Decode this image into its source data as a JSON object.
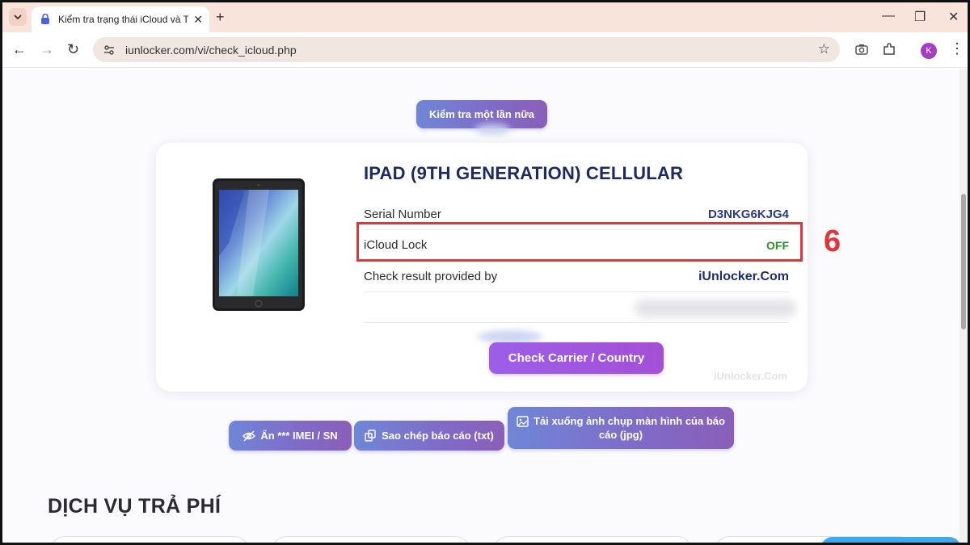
{
  "browser": {
    "tab_title": "Kiểm tra trạng thái iCloud và Tr",
    "url": "iunlocker.com/vi/check_icloud.php",
    "profile_initial": "K"
  },
  "page": {
    "check_again_label": "Kiểm tra một lần nữa",
    "product_title": "IPAD (9TH GENERATION) CELLULAR",
    "rows": [
      {
        "key": "Serial Number",
        "value": "D3NKG6KJG4"
      },
      {
        "key": "iCloud Lock",
        "value": "OFF"
      },
      {
        "key": "Check result provided by",
        "value": "iUnlocker.Com"
      }
    ],
    "check_carrier_label": "Check Carrier / Country",
    "watermark": "iUnlocker.Com",
    "step_number": "6",
    "actions": {
      "hide_label": "Ẩn *** IMEI / SN",
      "copy_label": "Sao chép báo cáo (txt)",
      "download_label_line1": "Tải xuống ảnh chụp màn hình của báo",
      "download_label_line2": "cáo (jpg)"
    },
    "section_title": "DỊCH VỤ TRẢ PHÍ"
  },
  "colors": {
    "title_navy": "#1d2a5e",
    "off_green": "#2f8f2a",
    "highlight_red": "#e2343a",
    "carrier_purple": "#9c5fe8"
  }
}
